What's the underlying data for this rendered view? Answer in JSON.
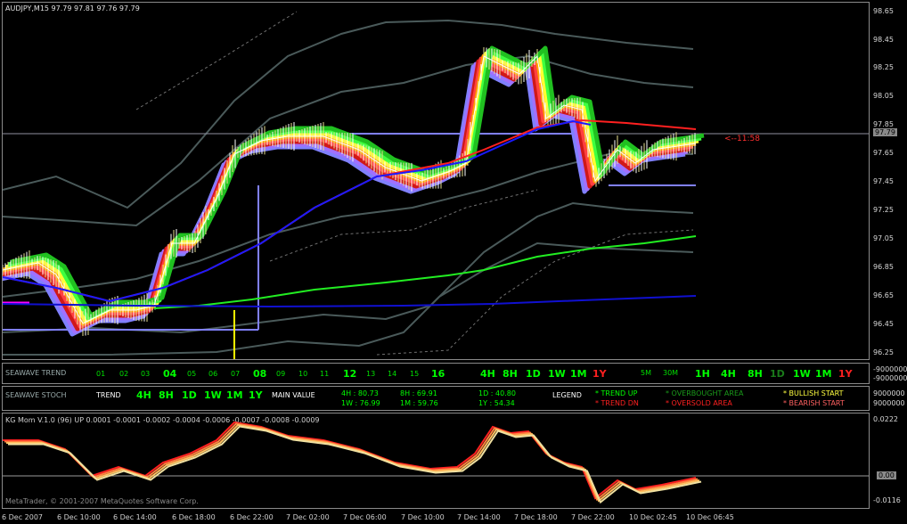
{
  "header": {
    "symbol_info": "AUDJPY,M15  97.79 97.81 97.76 97.79"
  },
  "price_scale": [
    "98.65",
    "98.45",
    "98.25",
    "98.05",
    "97.85",
    "97.65",
    "97.45",
    "97.25",
    "97.05",
    "96.85",
    "96.65",
    "96.45",
    "96.25"
  ],
  "current_price": "97.79",
  "countdown": "<--11:58",
  "trend_panel": {
    "name": "SEAWAVE TREND",
    "small_labels": [
      "01",
      "02",
      "03",
      "05",
      "06",
      "07",
      "09",
      "10",
      "11",
      "13",
      "14",
      "15"
    ],
    "big_labels": [
      "04",
      "08",
      "12",
      "16"
    ],
    "tf_left": [
      {
        "label": "4H",
        "color": "#00ff00"
      },
      {
        "label": "8H",
        "color": "#00ff00"
      },
      {
        "label": "1D",
        "color": "#00ff00"
      },
      {
        "label": "1W",
        "color": "#00ff00"
      },
      {
        "label": "1M",
        "color": "#00ff00"
      },
      {
        "label": "1Y",
        "color": "#ff2020"
      }
    ],
    "small_right": [
      "5M",
      "30M"
    ],
    "tf_right": [
      {
        "label": "1H",
        "color": "#00ff00"
      },
      {
        "label": "4H",
        "color": "#00ff00"
      },
      {
        "label": "8H",
        "color": "#00ff00"
      },
      {
        "label": "1D",
        "color": "#1a7a1a"
      },
      {
        "label": "1W",
        "color": "#00ff00"
      },
      {
        "label": "1M",
        "color": "#00ff00"
      },
      {
        "label": "1Y",
        "color": "#ff2020"
      }
    ],
    "scale_top": "-9000000",
    "scale_bottom": "-9000000"
  },
  "stoch_panel": {
    "name": "SEAWAVE STOCH",
    "trend_label": "TREND",
    "tf": [
      {
        "label": "4H",
        "color": "#00ff00"
      },
      {
        "label": "8H",
        "color": "#00ff00"
      },
      {
        "label": "1D",
        "color": "#00ff00"
      },
      {
        "label": "1W",
        "color": "#00ff00"
      },
      {
        "label": "1M",
        "color": "#00ff00"
      },
      {
        "label": "1Y",
        "color": "#00ff00"
      }
    ],
    "main_value_label": "MAIN VALUE",
    "values_row1": [
      "4H  : 80.73",
      "8H  : 69.91",
      "1D  : 40.80"
    ],
    "values_row2": [
      "1W : 76.99",
      "1M  : 59.76",
      "1Y  : 54.34"
    ],
    "legend_label": "LEGEND",
    "legend": {
      "trend_up": "* TREND UP",
      "trend_dn": "* TREND DN",
      "overbought": "* OVERBOUGHT AREA",
      "oversold": "* OVERSOLD AREA",
      "bullish": "* BULLISH START",
      "bearish": "* BEARISH START"
    },
    "scale_top": "9000000",
    "scale_bottom": "9000000"
  },
  "mom_panel": {
    "title": "KG Mom V.1.0 (96) UP 0.0001 -0.0001 -0.0002 -0.0004 -0.0006 -0.0007 -0.0008 -0.0009",
    "scale_top": "0.0222",
    "scale_zero": "0.00",
    "scale_bottom": "-0.0116"
  },
  "copyright": "MetaTrader, © 2001-2007 MetaQuotes Software Corp.",
  "time_axis": [
    "6 Dec 2007",
    "6 Dec 10:00",
    "6 Dec 14:00",
    "6 Dec 18:00",
    "6 Dec 22:00",
    "7 Dec 02:00",
    "7 Dec 06:00",
    "7 Dec 10:00",
    "7 Dec 14:00",
    "7 Dec 18:00",
    "7 Dec 22:00",
    "10 Dec 02:45",
    "10 Dec 06:45"
  ],
  "colors": {
    "background": "#000000",
    "frame": "#8a8a8a",
    "blue_ma": "#1a1aff",
    "green_ma": "#22ee22",
    "red_line": "#ff2020",
    "band_gray": "#4a5a5a",
    "level_line": "#8080ff"
  }
}
